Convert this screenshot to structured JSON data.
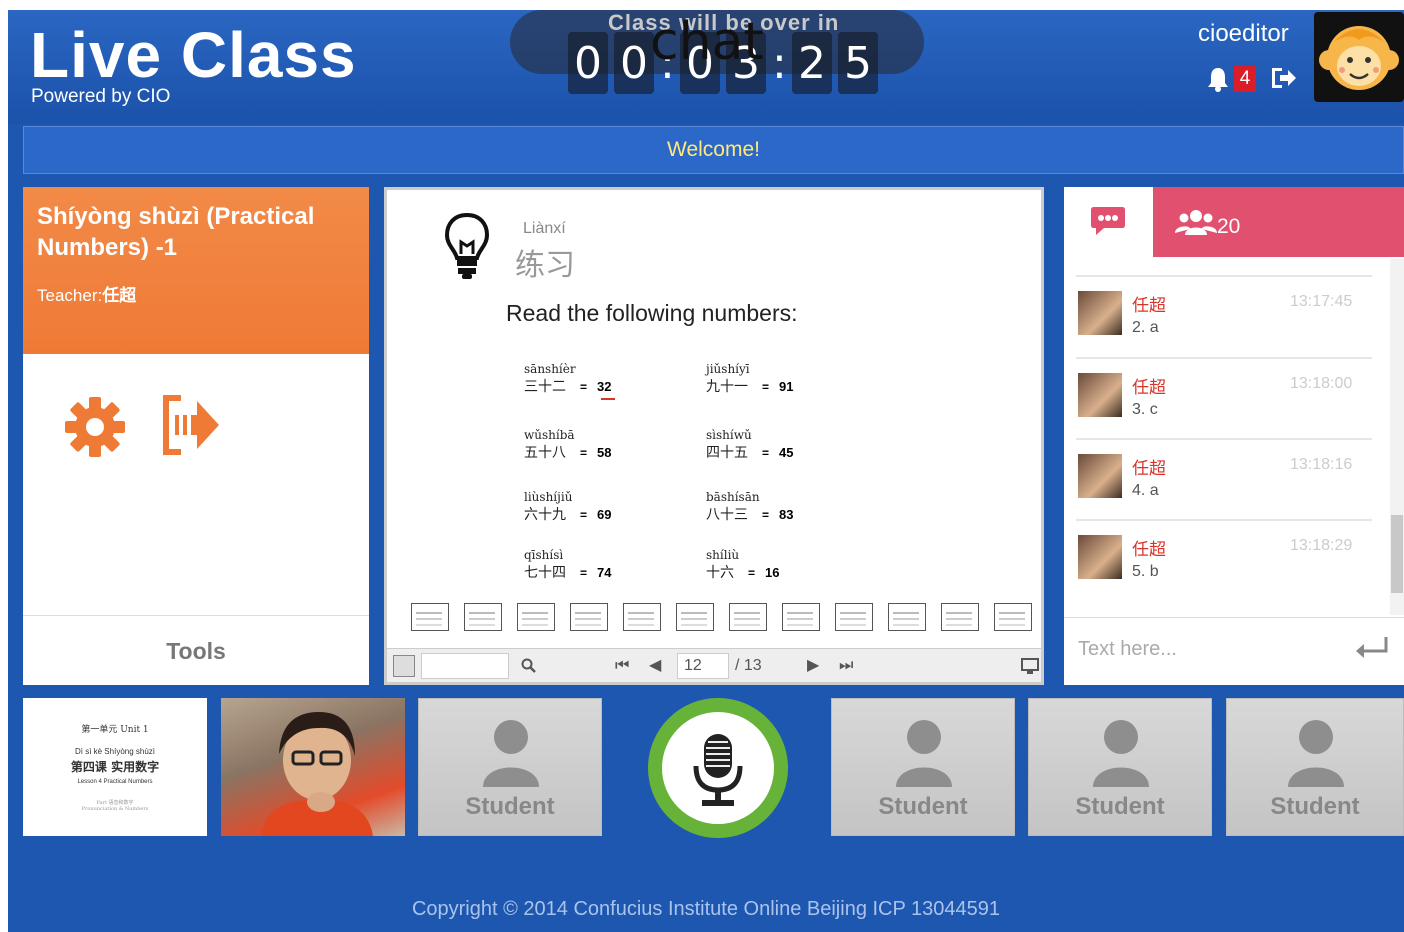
{
  "header": {
    "app_title": "Live Class",
    "app_subtitle": "Powered by CIO",
    "timer_label": "Class will be over in",
    "timer_digits": [
      "0",
      "0",
      ":",
      "0",
      "3",
      ":",
      "2",
      "5"
    ],
    "overlay_text": "chat",
    "username": "cioeditor",
    "notification_count": "4"
  },
  "welcome": "Welcome!",
  "course": {
    "title": "Shíyòng shùzì (Practical Numbers) -1",
    "teacher_label": "Teacher:",
    "teacher_name": "任超",
    "tools_label": "Tools"
  },
  "slide": {
    "pinyin_heading": "Liànxí",
    "hanzi_heading": "练习",
    "instruction": "Read the following numbers:",
    "exercises": [
      {
        "pinyin": "sānshíèr",
        "hanzi": "三十二",
        "value": "32"
      },
      {
        "pinyin": "jiǔshíyī",
        "hanzi": "九十一",
        "value": "91"
      },
      {
        "pinyin": "wǔshíbā",
        "hanzi": "五十八",
        "value": "58"
      },
      {
        "pinyin": "sìshíwǔ",
        "hanzi": "四十五",
        "value": "45"
      },
      {
        "pinyin": "liùshíjiǔ",
        "hanzi": "六十九",
        "value": "69"
      },
      {
        "pinyin": "bāshísān",
        "hanzi": "八十三",
        "value": "83"
      },
      {
        "pinyin": "qīshísì",
        "hanzi": "七十四",
        "value": "74"
      },
      {
        "pinyin": "shíliù",
        "hanzi": "十六",
        "value": "16"
      }
    ],
    "current_page": "12",
    "total_pages": "/ 13"
  },
  "chat": {
    "user_count": "20",
    "messages": [
      {
        "name": "任超",
        "text": "2. a",
        "time": "13:17:45"
      },
      {
        "name": "任超",
        "text": "3. c",
        "time": "13:18:00"
      },
      {
        "name": "任超",
        "text": "4. a",
        "time": "13:18:16"
      },
      {
        "name": "任超",
        "text": "5. b",
        "time": "13:18:29"
      }
    ],
    "input_placeholder": "Text here..."
  },
  "book_cover": {
    "line1": "第一单元 Unit 1",
    "line2": "Dì sì kè  Shíyòng shùzì",
    "line3": "第四课  实用数字",
    "line4": "Lesson 4  Practical Numbers",
    "line5": "Part 语音和数字",
    "line6": "Pronunciation & Numbers"
  },
  "students": [
    "Student",
    "Student",
    "Student",
    "Student"
  ],
  "footer": "Copyright © 2014 Confucius Institute Online Beijing ICP 13044591",
  "colors": {
    "accent_blue": "#1e57b0",
    "course_orange": "#ef7a36",
    "users_tab": "#e2506f",
    "mic_ring": "#67b339"
  }
}
